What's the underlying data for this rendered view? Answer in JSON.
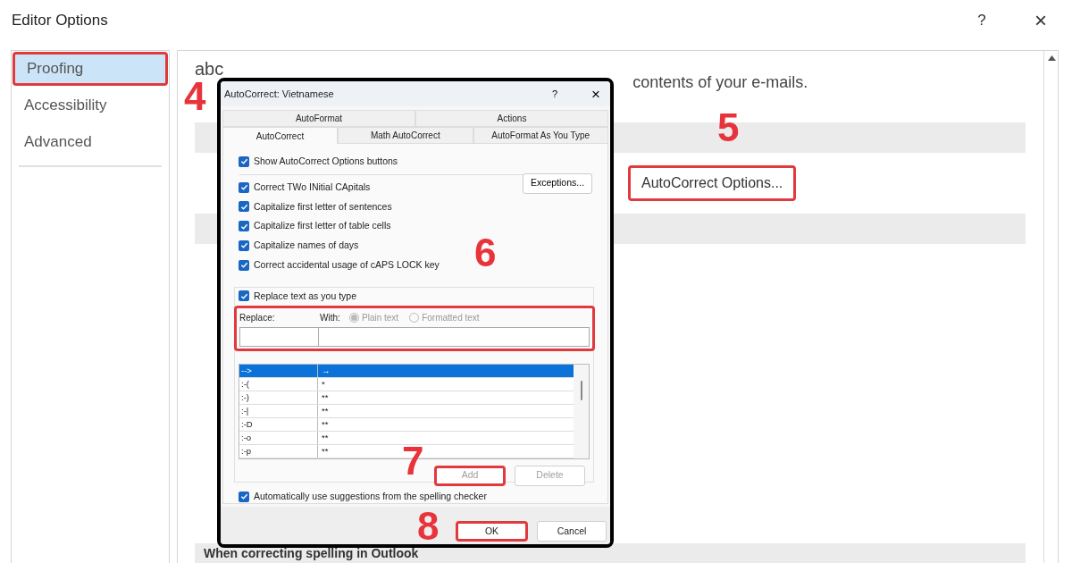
{
  "window": {
    "title": "Editor Options",
    "help": "?",
    "close": "×"
  },
  "sidebar": {
    "items": [
      {
        "label": "Proofing",
        "selected": true,
        "highlighted": true,
        "step": "4"
      },
      {
        "label": "Accessibility",
        "selected": false,
        "highlighted": false
      },
      {
        "label": "Advanced",
        "selected": false,
        "highlighted": false
      }
    ]
  },
  "content": {
    "icon_text": "abc",
    "description": "contents of your e-mails.",
    "autocorrect_button": {
      "label": "AutoCorrect Options...",
      "highlighted": true,
      "step": "5"
    },
    "section_heading": "When correcting spelling in Outlook"
  },
  "dialog": {
    "title": "AutoCorrect: Vietnamese",
    "help": "?",
    "close": "×",
    "tab_rows": [
      [
        {
          "label": "AutoFormat",
          "selected": false
        },
        {
          "label": "Actions",
          "selected": false
        }
      ],
      [
        {
          "label": "AutoCorrect",
          "selected": true
        },
        {
          "label": "Math AutoCorrect",
          "selected": false
        },
        {
          "label": "AutoFormat As You Type",
          "selected": false
        }
      ]
    ],
    "options": [
      {
        "label": "Show AutoCorrect Options buttons",
        "checked": true
      },
      {
        "label": "Correct TWo INitial CApitals",
        "checked": true
      },
      {
        "label": "Capitalize first letter of sentences",
        "checked": true
      },
      {
        "label": "Capitalize first letter of table cells",
        "checked": true
      },
      {
        "label": "Capitalize names of days",
        "checked": true
      },
      {
        "label": "Correct accidental usage of cAPS LOCK key",
        "checked": true
      }
    ],
    "options_step": "6",
    "exceptions_button": "Exceptions...",
    "replace_checkbox": {
      "label": "Replace text as you type",
      "checked": true
    },
    "replace_box": {
      "replace_label": "Replace:",
      "with_label": "With:",
      "highlighted": true,
      "formats": [
        {
          "label": "Plain text",
          "selected": true
        },
        {
          "label": "Formatted text",
          "selected": false
        }
      ]
    },
    "entries": [
      {
        "replace": "-->",
        "with": "→",
        "selected": true
      },
      {
        "replace": ":-(",
        "with": "*",
        "selected": false
      },
      {
        "replace": ":-)",
        "with": "**",
        "selected": false
      },
      {
        "replace": ":-|",
        "with": "**",
        "selected": false
      },
      {
        "replace": ":-D",
        "with": "**",
        "selected": false
      },
      {
        "replace": ":-o",
        "with": "**",
        "selected": false
      },
      {
        "replace": ":-p",
        "with": "**",
        "selected": false
      }
    ],
    "add_button": {
      "label": "Add",
      "disabled": true,
      "highlighted": true,
      "step": "7"
    },
    "delete_button": {
      "label": "Delete",
      "disabled": true,
      "highlighted": false
    },
    "suggestions_checkbox": {
      "label": "Automatically use suggestions from the spelling checker",
      "checked": true
    },
    "ok_button": {
      "label": "OK",
      "highlighted": true,
      "step": "8"
    },
    "cancel_button": {
      "label": "Cancel",
      "highlighted": false
    }
  }
}
